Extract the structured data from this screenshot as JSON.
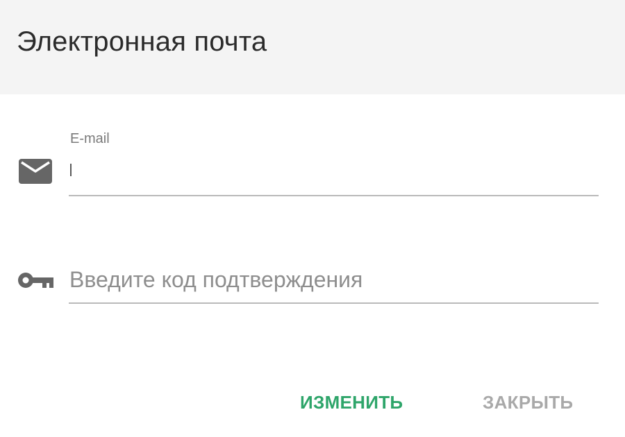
{
  "dialog": {
    "title": "Электронная почта"
  },
  "email_field": {
    "label": "E-mail",
    "value": "",
    "icon": "mail-icon"
  },
  "code_field": {
    "placeholder": "Введите код подтверждения",
    "value": "",
    "icon": "key-icon"
  },
  "actions": {
    "change_label": "ИЗМЕНИТЬ",
    "close_label": "ЗАКРЫТЬ"
  },
  "colors": {
    "header_background": "#f4f4f4",
    "accent": "#2ea56a",
    "disabled": "#a9a9a9",
    "icon": "#666666"
  }
}
